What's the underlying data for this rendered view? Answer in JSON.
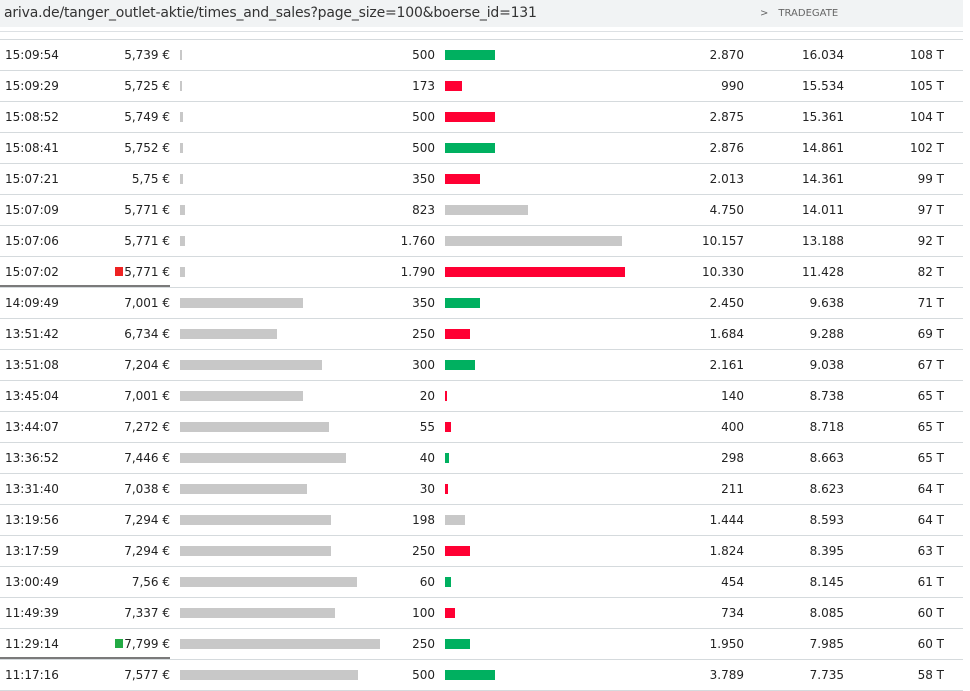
{
  "address_bar": {
    "url": "ariva.de/tanger_outlet-aktie/times_and_sales?page_size=100&boerse_id=131",
    "exchange_chevron": ">",
    "exchange": "TRADEGATE"
  },
  "colors": {
    "buy": "#00b060",
    "sell": "#ff0033",
    "neutral": "#c8c8c8",
    "marker_red": "#ee2222",
    "marker_green": "#22aa44"
  },
  "trades": [
    {
      "time": "15:09:54",
      "price": "5,739 €",
      "price_value": 5.739,
      "volume": "500",
      "volume_value": 500,
      "side": "buy",
      "turnover": "2.870",
      "cumulative": "16.034",
      "count": "108 T"
    },
    {
      "time": "15:09:29",
      "price": "5,725 €",
      "price_value": 5.725,
      "volume": "173",
      "volume_value": 173,
      "side": "sell",
      "turnover": "990",
      "cumulative": "15.534",
      "count": "105 T"
    },
    {
      "time": "15:08:52",
      "price": "5,749 €",
      "price_value": 5.749,
      "volume": "500",
      "volume_value": 500,
      "side": "sell",
      "turnover": "2.875",
      "cumulative": "15.361",
      "count": "104 T"
    },
    {
      "time": "15:08:41",
      "price": "5,752 €",
      "price_value": 5.752,
      "volume": "500",
      "volume_value": 500,
      "side": "buy",
      "turnover": "2.876",
      "cumulative": "14.861",
      "count": "102 T"
    },
    {
      "time": "15:07:21",
      "price": "5,75 €",
      "price_value": 5.75,
      "volume": "350",
      "volume_value": 350,
      "side": "sell",
      "turnover": "2.013",
      "cumulative": "14.361",
      "count": "99 T"
    },
    {
      "time": "15:07:09",
      "price": "5,771 €",
      "price_value": 5.771,
      "volume": "823",
      "volume_value": 823,
      "side": "neutral",
      "turnover": "4.750",
      "cumulative": "14.011",
      "count": "97 T"
    },
    {
      "time": "15:07:06",
      "price": "5,771 €",
      "price_value": 5.771,
      "volume": "1.760",
      "volume_value": 1760,
      "side": "neutral",
      "turnover": "10.157",
      "cumulative": "13.188",
      "count": "92 T"
    },
    {
      "time": "15:07:02",
      "price": "5,771 €",
      "price_value": 5.771,
      "volume": "1.790",
      "volume_value": 1790,
      "side": "sell",
      "turnover": "10.330",
      "cumulative": "11.428",
      "count": "82 T",
      "marker": "red"
    },
    {
      "time": "14:09:49",
      "price": "7,001 €",
      "price_value": 7.001,
      "volume": "350",
      "volume_value": 350,
      "side": "buy",
      "turnover": "2.450",
      "cumulative": "9.638",
      "count": "71 T"
    },
    {
      "time": "13:51:42",
      "price": "6,734 €",
      "price_value": 6.734,
      "volume": "250",
      "volume_value": 250,
      "side": "sell",
      "turnover": "1.684",
      "cumulative": "9.288",
      "count": "69 T"
    },
    {
      "time": "13:51:08",
      "price": "7,204 €",
      "price_value": 7.204,
      "volume": "300",
      "volume_value": 300,
      "side": "buy",
      "turnover": "2.161",
      "cumulative": "9.038",
      "count": "67 T"
    },
    {
      "time": "13:45:04",
      "price": "7,001 €",
      "price_value": 7.001,
      "volume": "20",
      "volume_value": 20,
      "side": "sell",
      "turnover": "140",
      "cumulative": "8.738",
      "count": "65 T"
    },
    {
      "time": "13:44:07",
      "price": "7,272 €",
      "price_value": 7.272,
      "volume": "55",
      "volume_value": 55,
      "side": "sell",
      "turnover": "400",
      "cumulative": "8.718",
      "count": "65 T"
    },
    {
      "time": "13:36:52",
      "price": "7,446 €",
      "price_value": 7.446,
      "volume": "40",
      "volume_value": 40,
      "side": "buy",
      "turnover": "298",
      "cumulative": "8.663",
      "count": "65 T"
    },
    {
      "time": "13:31:40",
      "price": "7,038 €",
      "price_value": 7.038,
      "volume": "30",
      "volume_value": 30,
      "side": "sell",
      "turnover": "211",
      "cumulative": "8.623",
      "count": "64 T"
    },
    {
      "time": "13:19:56",
      "price": "7,294 €",
      "price_value": 7.294,
      "volume": "198",
      "volume_value": 198,
      "side": "neutral",
      "turnover": "1.444",
      "cumulative": "8.593",
      "count": "64 T"
    },
    {
      "time": "13:17:59",
      "price": "7,294 €",
      "price_value": 7.294,
      "volume": "250",
      "volume_value": 250,
      "side": "sell",
      "turnover": "1.824",
      "cumulative": "8.395",
      "count": "63 T"
    },
    {
      "time": "13:00:49",
      "price": "7,56 €",
      "price_value": 7.56,
      "volume": "60",
      "volume_value": 60,
      "side": "buy",
      "turnover": "454",
      "cumulative": "8.145",
      "count": "61 T"
    },
    {
      "time": "11:49:39",
      "price": "7,337 €",
      "price_value": 7.337,
      "volume": "100",
      "volume_value": 100,
      "side": "sell",
      "turnover": "734",
      "cumulative": "8.085",
      "count": "60 T"
    },
    {
      "time": "11:29:14",
      "price": "7,799 €",
      "price_value": 7.799,
      "volume": "250",
      "volume_value": 250,
      "side": "buy",
      "turnover": "1.950",
      "cumulative": "7.985",
      "count": "60 T",
      "marker": "green"
    },
    {
      "time": "11:17:16",
      "price": "7,577 €",
      "price_value": 7.577,
      "volume": "500",
      "volume_value": 500,
      "side": "buy",
      "turnover": "3.789",
      "cumulative": "7.735",
      "count": "58 T"
    }
  ]
}
